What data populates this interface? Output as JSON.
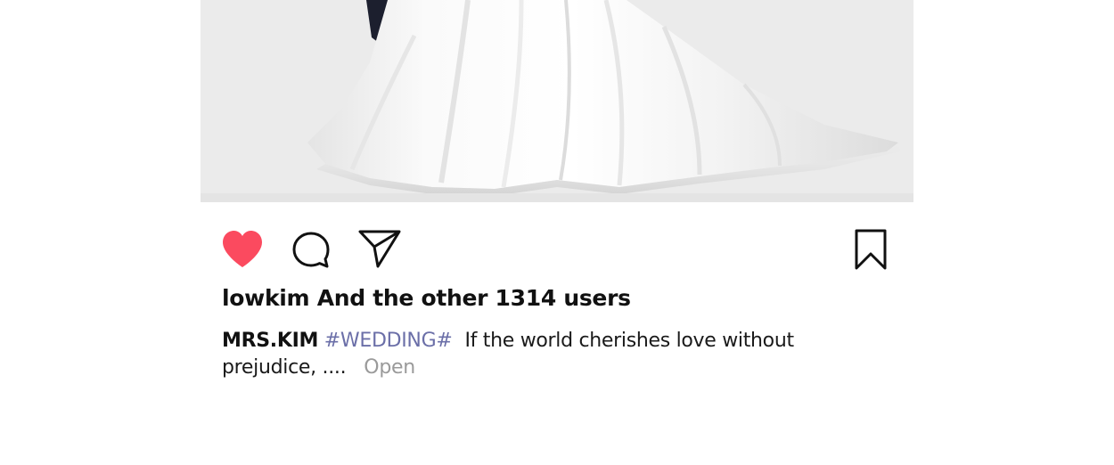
{
  "post": {
    "photo_alt": "",
    "actions": {
      "like_icon": "heart-filled-icon",
      "comment_icon": "comment-bubble-icon",
      "share_icon": "paper-plane-icon",
      "bookmark_icon": "bookmark-icon",
      "like_color": "#fb4a5f"
    },
    "likes_text": "lowkim And the other 1314 users",
    "caption": {
      "username": "MRS.KIM",
      "hashtag": "#WEDDING#",
      "text": "If the world cherishes love without prejudice, ....",
      "more_label": "Open"
    }
  }
}
